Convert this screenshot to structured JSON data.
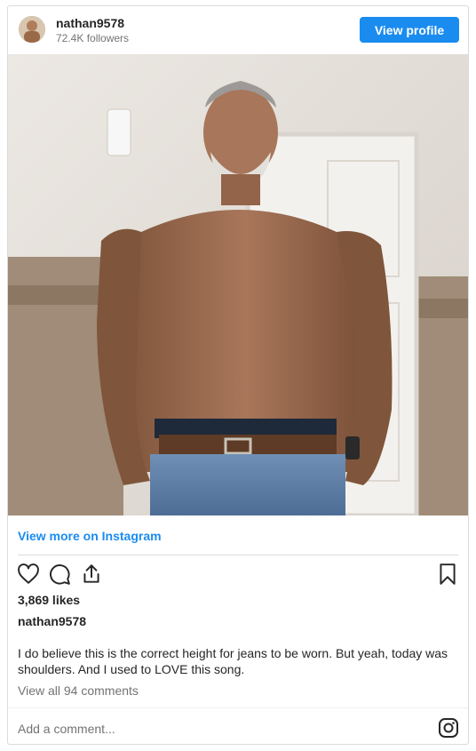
{
  "header": {
    "username": "nathan9578",
    "followers": "72.4K followers",
    "view_profile_label": "View profile"
  },
  "post": {
    "view_more_label": "View more on Instagram",
    "likes": "3,869 likes",
    "caption_user": "nathan9578",
    "caption_text": "I do believe this is the correct height for jeans to be worn. But yeah, today was shoulders. And I used to LOVE this song.",
    "comments_link": "View all 94 comments",
    "comment_placeholder": "Add a comment..."
  },
  "icons": {
    "like": "heart-icon",
    "comment": "comment-icon",
    "share": "share-icon",
    "save": "bookmark-icon",
    "brand": "instagram-icon"
  },
  "colors": {
    "accent": "#1a8cf0",
    "text": "#262626",
    "muted": "#737373",
    "border": "#dbdbdb"
  }
}
